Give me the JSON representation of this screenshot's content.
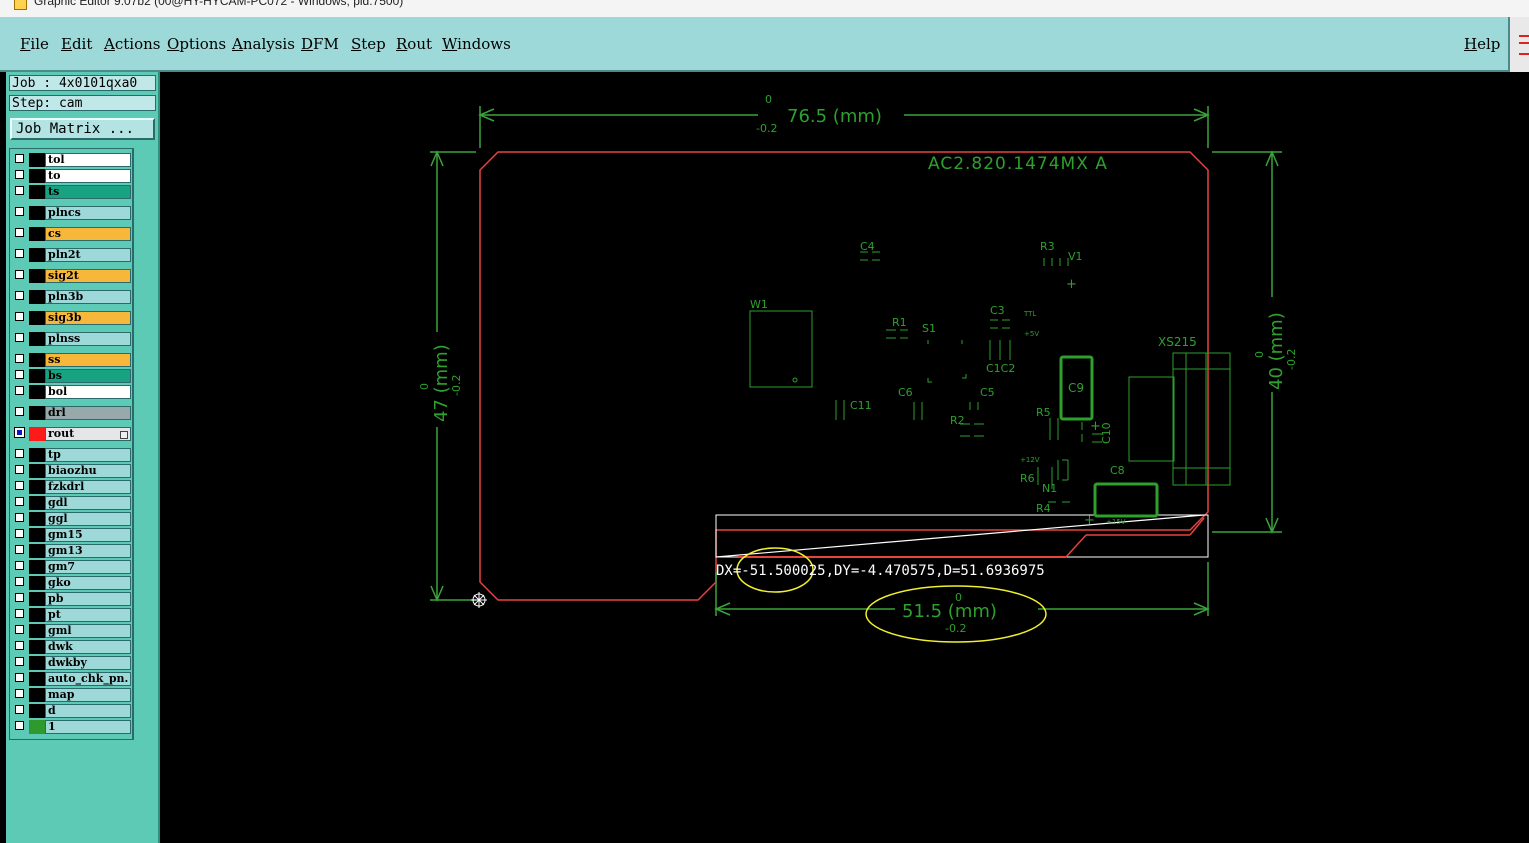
{
  "window": {
    "title": "Graphic Editor 9.07b2 (00@HY-HYCAM-PC072 - Windows, pid:7500)"
  },
  "menu": {
    "file": "File",
    "edit": "Edit",
    "actions": "Actions",
    "options": "Options",
    "analysis": "Analysis",
    "dfm": "DFM",
    "step": "Step",
    "rout": "Rout",
    "windows": "Windows",
    "help": "Help"
  },
  "job": {
    "label": "Job : 4x0101qxa0",
    "step_label": "Step: cam",
    "matrix_button": "Job Matrix ..."
  },
  "layers": [
    {
      "name": "tol",
      "bg": "white"
    },
    {
      "name": "to",
      "bg": "white"
    },
    {
      "name": "ts",
      "bg": "teal"
    },
    {
      "name": "plncs",
      "bg": "light"
    },
    {
      "name": "cs",
      "bg": "orange"
    },
    {
      "name": "pln2t",
      "bg": "light"
    },
    {
      "name": "sig2t",
      "bg": "orange"
    },
    {
      "name": "pln3b",
      "bg": "light"
    },
    {
      "name": "sig3b",
      "bg": "orange"
    },
    {
      "name": "plnss",
      "bg": "light"
    },
    {
      "name": "ss",
      "bg": "orange"
    },
    {
      "name": "bs",
      "bg": "teal"
    },
    {
      "name": "bol",
      "bg": "white"
    },
    {
      "name": "drl",
      "bg": "gray"
    },
    {
      "name": "rout",
      "bg": "selected",
      "active": true,
      "color": "#ff1a1a"
    },
    {
      "name": "tp",
      "bg": "light"
    },
    {
      "name": "biaozhu",
      "bg": "light"
    },
    {
      "name": "fzkdrl",
      "bg": "light"
    },
    {
      "name": "gdl",
      "bg": "light"
    },
    {
      "name": "ggl",
      "bg": "light"
    },
    {
      "name": "gm15",
      "bg": "light"
    },
    {
      "name": "gm13",
      "bg": "light"
    },
    {
      "name": "gm7",
      "bg": "light"
    },
    {
      "name": "gko",
      "bg": "light"
    },
    {
      "name": "pb",
      "bg": "light"
    },
    {
      "name": "pt",
      "bg": "light"
    },
    {
      "name": "gml",
      "bg": "light"
    },
    {
      "name": "dwk",
      "bg": "light"
    },
    {
      "name": "dwkby",
      "bg": "light"
    },
    {
      "name": "auto_chk_pn.",
      "bg": "light"
    },
    {
      "name": "map",
      "bg": "light"
    },
    {
      "name": "d",
      "bg": "light"
    },
    {
      "name": "1",
      "bg": "light",
      "color": "#2e9a2e"
    }
  ],
  "canvas": {
    "measure_readout": "DX=-51.500025,DY=-4.470575,D=51.6936975",
    "dims": {
      "top": "76.5 (mm)",
      "left": "47 (mm)",
      "right": "40 (mm)",
      "bottom": "51.5 (mm)",
      "tol_plus": "0",
      "tol_minus": "-0.2"
    },
    "board_label": "AC2.820.1474MX  A",
    "refs": [
      "C4",
      "R3",
      "V1",
      "W1",
      "R1",
      "S1",
      "C3",
      "C1C2",
      "XS215",
      "C9",
      "C6",
      "C5",
      "C11",
      "R2",
      "R5",
      "C10",
      "R6",
      "C8",
      "N1",
      "R4",
      "+15V",
      "+5V",
      "TTL",
      "+12V",
      "+"
    ]
  },
  "colors": {
    "menubar": "#9ed9d9",
    "leftpanel": "#5ccab5",
    "silk": "#2ea02e",
    "dim": "#3aa43a",
    "rout": "#e8423c",
    "highlight": "#f1ef2e"
  }
}
